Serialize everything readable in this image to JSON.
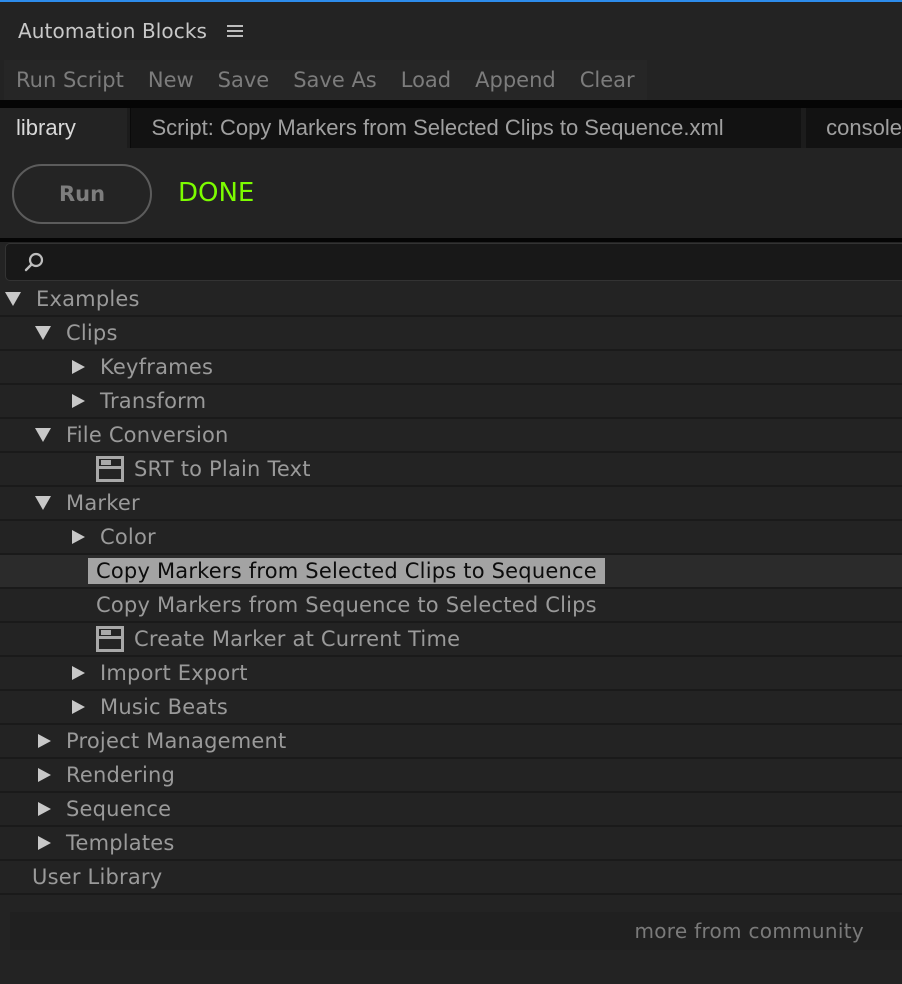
{
  "panel": {
    "title": "Automation Blocks",
    "menu_icon": "hamburger-icon"
  },
  "menubar": {
    "items": [
      "Run Script",
      "New",
      "Save",
      "Save As",
      "Load",
      "Append",
      "Clear"
    ]
  },
  "tabs": [
    {
      "label": "library",
      "active": true
    },
    {
      "label": "Script: Copy Markers from Selected Clips to Sequence.xml",
      "active": false
    },
    {
      "label": "console",
      "active": false
    }
  ],
  "run": {
    "button_label": "Run",
    "status": "DONE",
    "status_color": "#7cfc00"
  },
  "search": {
    "icon": "search-icon",
    "value": "",
    "placeholder": ""
  },
  "tree": [
    {
      "label": "Examples",
      "level": 0,
      "type": "folder",
      "expanded": true
    },
    {
      "label": "Clips",
      "level": 1,
      "type": "folder",
      "expanded": true
    },
    {
      "label": "Keyframes",
      "level": 2,
      "type": "folder",
      "expanded": false
    },
    {
      "label": "Transform",
      "level": 2,
      "type": "folder",
      "expanded": false
    },
    {
      "label": "File Conversion",
      "level": 1,
      "type": "folder",
      "expanded": true
    },
    {
      "label": "SRT to Plain Text",
      "level": 2,
      "type": "script-ui"
    },
    {
      "label": "Marker",
      "level": 1,
      "type": "folder",
      "expanded": true
    },
    {
      "label": "Color",
      "level": 2,
      "type": "folder",
      "expanded": false
    },
    {
      "label": "Copy Markers from Selected Clips to Sequence",
      "level": 2,
      "type": "script",
      "selected": true
    },
    {
      "label": "Copy Markers from Sequence to Selected Clips",
      "level": 2,
      "type": "script"
    },
    {
      "label": "Create Marker at Current Time",
      "level": 2,
      "type": "script-ui"
    },
    {
      "label": "Import Export",
      "level": 2,
      "type": "folder",
      "expanded": false
    },
    {
      "label": "Music Beats",
      "level": 2,
      "type": "folder",
      "expanded": false
    },
    {
      "label": "Project Management",
      "level": 1,
      "type": "folder",
      "expanded": false
    },
    {
      "label": "Rendering",
      "level": 1,
      "type": "folder",
      "expanded": false
    },
    {
      "label": "Sequence",
      "level": 1,
      "type": "folder",
      "expanded": false
    },
    {
      "label": "Templates",
      "level": 1,
      "type": "folder",
      "expanded": false
    },
    {
      "label": "User Library",
      "level": 0,
      "type": "leaf"
    }
  ],
  "footer": {
    "link_label": "more from community"
  }
}
